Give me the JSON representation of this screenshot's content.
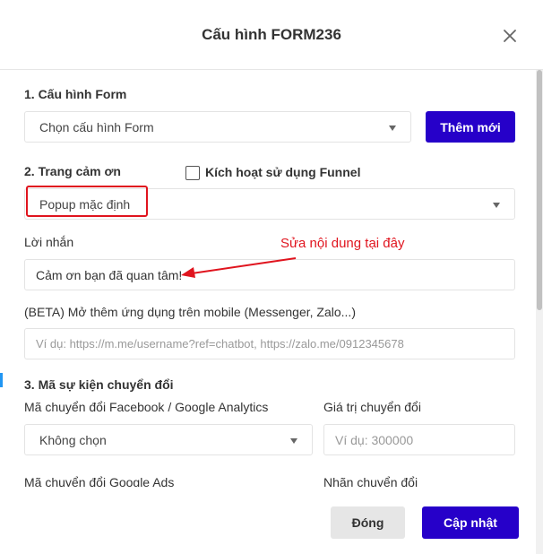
{
  "modal": {
    "title": "Cấu hình FORM236"
  },
  "section1": {
    "heading": "1. Cấu hình Form",
    "select_value": "Chọn cấu hình Form",
    "add_button": "Thêm mới"
  },
  "section2": {
    "heading": "2. Trang cảm ơn",
    "funnel_checkbox_label": "Kích hoạt sử dụng Funnel",
    "funnel_checked": false,
    "popup_select_value": "Popup mặc định",
    "message_label": "Lời nhắn",
    "message_value": "Cảm ơn bạn đã quan tâm!",
    "annotation": "Sửa nội dung tại đây",
    "beta_label": "(BETA) Mở thêm ứng dụng trên mobile (Messenger, Zalo...)",
    "beta_placeholder": "Ví dụ: https://m.me/username?ref=chatbot, https://zalo.me/0912345678"
  },
  "section3": {
    "heading": "3. Mã sự kiện chuyển đổi",
    "fb_ga_label": "Mã chuyển đổi Facebook / Google Analytics",
    "fb_ga_select_value": "Không chọn",
    "conversion_value_label": "Giá trị chuyển đổi",
    "conversion_value_placeholder": "Ví dụ: 300000",
    "google_ads_label": "Mã chuyển đổi Google Ads",
    "conversion_label_label": "Nhãn chuyển đổi"
  },
  "footer": {
    "close_button": "Đóng",
    "update_button": "Cập nhật"
  },
  "colors": {
    "primary": "#2600c9",
    "annotation_red": "#e0141e"
  }
}
